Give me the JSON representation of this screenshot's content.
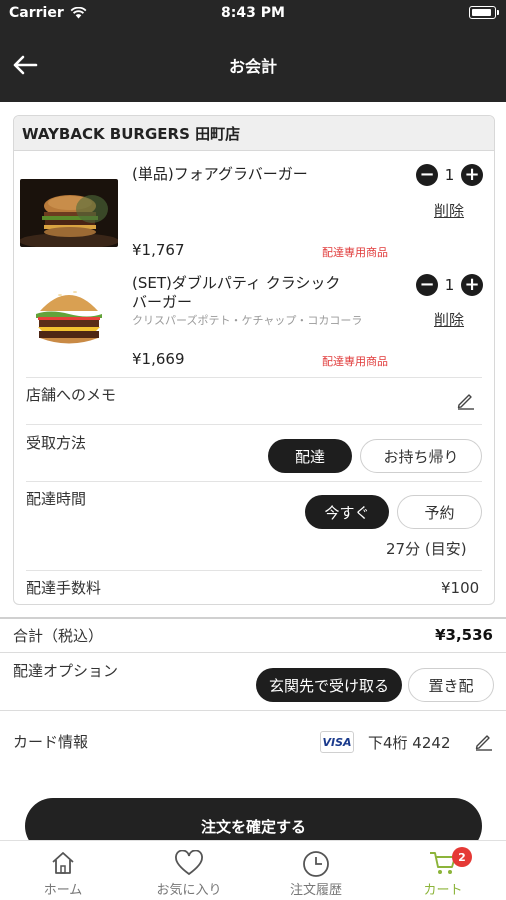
{
  "status_bar": {
    "carrier": "Carrier",
    "time": "8:43 PM"
  },
  "nav": {
    "title": "お会計"
  },
  "shop": {
    "name": "WAYBACK BURGERS 田町店",
    "items": [
      {
        "name": "(単品)フォアグラバーガー",
        "sub": "",
        "price": "¥1,767",
        "tag": "配達専用商品",
        "qty": "1",
        "delete_label": "削除",
        "image": "foie-gras-burger-image"
      },
      {
        "name_line1": "(SET)ダブルパティ クラシック",
        "name_line2": "バーガー",
        "sub": "クリスパーズポテト・ケチャップ・コカコーラ",
        "price": "¥1,669",
        "tag": "配達専用商品",
        "qty": "1",
        "delete_label": "削除",
        "image": "double-patty-burger-image"
      }
    ],
    "memo_label": "店舗へのメモ",
    "receive": {
      "label": "受取方法",
      "options": [
        "配達",
        "お持ち帰り"
      ],
      "selected": "配達"
    },
    "delivery_time": {
      "label": "配達時間",
      "options": [
        "今すぐ",
        "予約"
      ],
      "selected": "今すぐ",
      "estimate": "27分 (目安)"
    },
    "fee": {
      "label": "配達手数料",
      "value": "¥100"
    }
  },
  "total": {
    "label": "合計（税込）",
    "value": "¥3,536"
  },
  "delivery_option": {
    "label": "配達オプション",
    "options": [
      "玄関先で受け取る",
      "置き配"
    ],
    "selected": "玄関先で受け取る"
  },
  "card": {
    "label": "カード情報",
    "brand": "VISA",
    "number": "下4桁 4242"
  },
  "confirm_label": "注文を確定する",
  "tabs": [
    {
      "label": "ホーム",
      "icon": "home-icon"
    },
    {
      "label": "お気に入り",
      "icon": "heart-icon"
    },
    {
      "label": "注文履歴",
      "icon": "clock-icon"
    },
    {
      "label": "カート",
      "icon": "cart-icon",
      "badge": "2",
      "active": true
    }
  ],
  "colors": {
    "header": "#262626",
    "accent_green": "#8cb43a",
    "tag_red": "#e03a3a",
    "badge_red": "#e53935"
  }
}
